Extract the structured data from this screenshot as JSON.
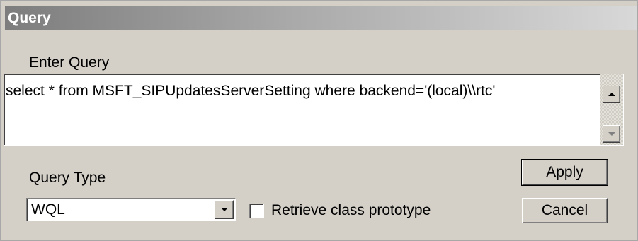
{
  "window": {
    "title": "Query"
  },
  "query": {
    "label": "Enter Query",
    "text": "select * from MSFT_SIPUpdatesServerSetting where backend='(local)\\\\rtc'"
  },
  "query_type": {
    "label": "Query Type",
    "selected": "WQL"
  },
  "options": {
    "retrieve_prototype_label": "Retrieve class prototype",
    "retrieve_prototype_checked": false
  },
  "buttons": {
    "apply": "Apply",
    "cancel": "Cancel"
  }
}
